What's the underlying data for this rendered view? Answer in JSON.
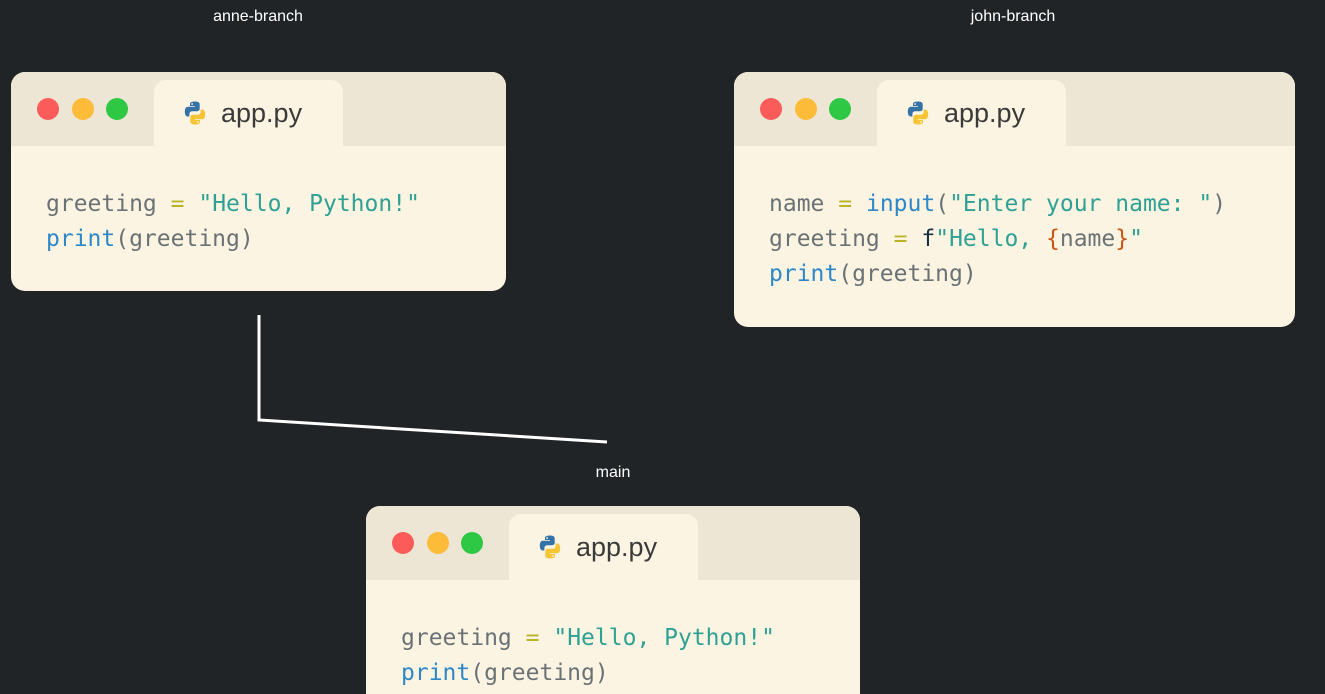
{
  "branches": {
    "anne": {
      "label": "anne-branch",
      "tab": "app.py",
      "code": [
        [
          {
            "t": "greeting",
            "c": "var"
          },
          {
            "t": " ",
            "c": "var"
          },
          {
            "t": "=",
            "c": "op"
          },
          {
            "t": " ",
            "c": "var"
          },
          {
            "t": "\"Hello, Python!\"",
            "c": "str"
          }
        ],
        [
          {
            "t": "print",
            "c": "fn"
          },
          {
            "t": "(greeting)",
            "c": "pun"
          }
        ]
      ]
    },
    "john": {
      "label": "john-branch",
      "tab": "app.py",
      "code": [
        [
          {
            "t": "name",
            "c": "var"
          },
          {
            "t": " ",
            "c": "var"
          },
          {
            "t": "=",
            "c": "op"
          },
          {
            "t": " ",
            "c": "var"
          },
          {
            "t": "input",
            "c": "fn"
          },
          {
            "t": "(",
            "c": "pun"
          },
          {
            "t": "\"Enter your name: \"",
            "c": "str"
          },
          {
            "t": ")",
            "c": "pun"
          }
        ],
        [
          {
            "t": "greeting",
            "c": "var"
          },
          {
            "t": " ",
            "c": "var"
          },
          {
            "t": "=",
            "c": "op"
          },
          {
            "t": " ",
            "c": "var"
          },
          {
            "t": "f",
            "c": "pref"
          },
          {
            "t": "\"Hello, ",
            "c": "str"
          },
          {
            "t": "{",
            "c": "brace"
          },
          {
            "t": "name",
            "c": "var"
          },
          {
            "t": "}",
            "c": "brace"
          },
          {
            "t": "\"",
            "c": "str"
          }
        ],
        [
          {
            "t": "print",
            "c": "fn"
          },
          {
            "t": "(greeting)",
            "c": "pun"
          }
        ]
      ]
    },
    "main": {
      "label": "main",
      "tab": "app.py",
      "code": [
        [
          {
            "t": "greeting",
            "c": "var"
          },
          {
            "t": " ",
            "c": "var"
          },
          {
            "t": "=",
            "c": "op"
          },
          {
            "t": " ",
            "c": "var"
          },
          {
            "t": "\"Hello, Python!\"",
            "c": "str"
          }
        ],
        [
          {
            "t": "print",
            "c": "fn"
          },
          {
            "t": "(greeting)",
            "c": "pun"
          }
        ]
      ]
    }
  },
  "icons": {
    "traffic_lights": [
      "close-dot",
      "minimize-dot",
      "maximize-dot"
    ],
    "file_icon": "python-icon"
  },
  "colors": {
    "background": "#212426",
    "window_body": "#fcf4e3",
    "titlebar": "#ede6d4",
    "close": "#fb5c5a",
    "minimize": "#fdbb3a",
    "maximize": "#2ec845",
    "string": "#2ea194",
    "function": "#2e88c7",
    "operator": "#b8b327",
    "variable": "#6a7276",
    "brace": "#c95514"
  }
}
